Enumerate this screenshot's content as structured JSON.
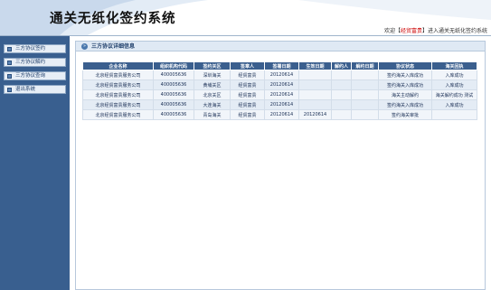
{
  "header": {
    "title": "通关无纸化签约系统",
    "welcome_prefix": "欢迎【",
    "welcome_user": "经贸富贵",
    "welcome_suffix": "】进入通关无纸化签约系统"
  },
  "sidebar": {
    "items": [
      {
        "label": "三方协议签约"
      },
      {
        "label": "三方协议解约"
      },
      {
        "label": "三方协议查询"
      },
      {
        "label": "退出系统"
      }
    ]
  },
  "panel": {
    "title": "三方协议详细信息",
    "columns": [
      "企业名称",
      "组织机构代码",
      "签约关区",
      "签章人",
      "签署日期",
      "生效日期",
      "解约人",
      "解约日期",
      "协议状态",
      "海关回执"
    ],
    "rows": [
      [
        "北京经贸富贵服务公司",
        "400005636",
        "深圳海关",
        "经贸富贵",
        "20120614",
        "",
        "",
        "",
        "签约海关入库成功",
        "入库成功"
      ],
      [
        "北京经贸富贵服务公司",
        "400005636",
        "黄埔关区",
        "经贸富贵",
        "20120614",
        "",
        "",
        "",
        "签约海关入库成功",
        "入库成功"
      ],
      [
        "北京经贸富贵服务公司",
        "400005636",
        "北京关区",
        "经贸富贵",
        "20120614",
        "",
        "",
        "",
        "海关主动解约",
        "海关解约成功 测试"
      ],
      [
        "北京经贸富贵服务公司",
        "400005636",
        "大连海关",
        "经贸富贵",
        "20120614",
        "",
        "",
        "",
        "签约海关入库成功",
        "入库成功"
      ],
      [
        "北京经贸富贵服务公司",
        "400005636",
        "青岛海关",
        "经贸富贵",
        "20120614",
        "20120614",
        "",
        "",
        "签约海关审批",
        ""
      ]
    ]
  },
  "colors": {
    "sidebar_bg": "#395f8f",
    "table_header_bg": "#3b5f8e",
    "accent_red": "#cc0000"
  }
}
